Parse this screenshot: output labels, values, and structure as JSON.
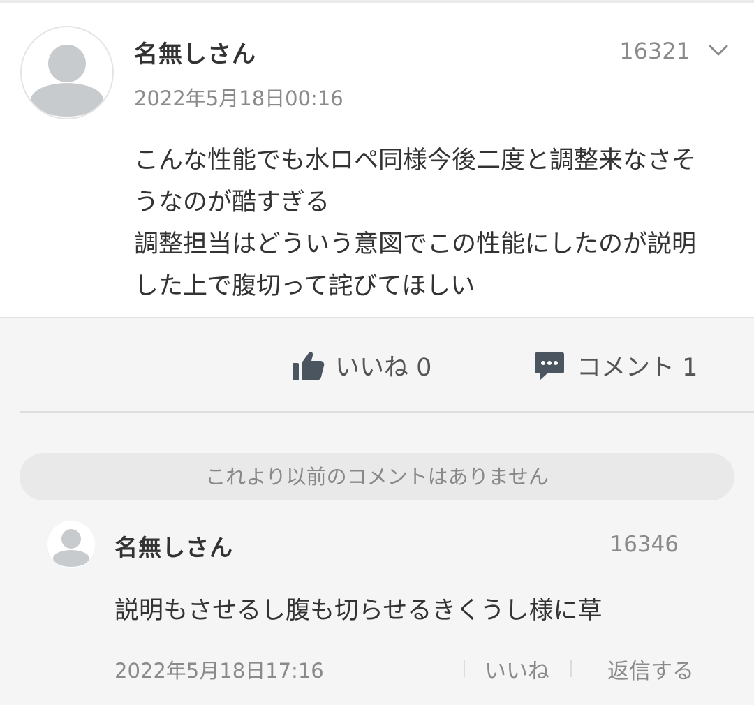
{
  "post": {
    "author": "名無しさん",
    "id": "16321",
    "date": "2022年5月18日00:16",
    "body_lines": [
      "こんな性能でも水ロペ同様今後二度と調整来なさそ",
      "うなのが酷すぎる",
      "調整担当はどういう意図でこの性能にしたのが説明",
      "した上で腹切って詫びてほしい"
    ]
  },
  "actions": {
    "like_label": "いいね 0",
    "comment_label": "コメント 1"
  },
  "no_earlier_notice": "これより以前のコメントはありません",
  "comment": {
    "author": "名無しさん",
    "id": "16346",
    "body": "説明もさせるし腹も切らせるきくうし様に草",
    "date": "2022年5月18日17:16",
    "like_label": "いいね",
    "reply_label": "返信する"
  },
  "icons": {
    "avatar": "default-user-avatar-icon",
    "menu": "chevron-down-icon",
    "like": "thumbs-up-icon",
    "comment": "speech-bubble-icon"
  },
  "colors": {
    "text": "#333333",
    "muted": "#8a8a8a",
    "icon": "#4a5560",
    "avatar_gray": "#c7cbce"
  }
}
